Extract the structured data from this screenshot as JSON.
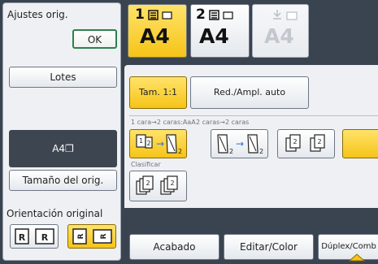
{
  "left": {
    "ajustes_label": "Ajustes orig.",
    "ok_label": "OK",
    "lotes_label": "Lotes",
    "paper_label": "A4❐",
    "tamano_label": "Tamaño del orig.",
    "orientacion_label": "Orientación original"
  },
  "trays": [
    {
      "number": "1",
      "size": "A4"
    },
    {
      "number": "2",
      "size": "A4"
    },
    {
      "number": "",
      "size": "A4"
    }
  ],
  "reduce": {
    "tam_label": "Tam. 1:1",
    "red_label": "Red./Ampl. auto"
  },
  "duplex": {
    "mode1": "1 cara→2 caras:AaA",
    "mode2": "2 caras→2 caras"
  },
  "sort": {
    "clasificar_label": "Clasificar"
  },
  "bottom": {
    "acabado": "Acabado",
    "editar": "Editar/Color",
    "duplex": "Dúplex/Comb"
  },
  "colors": {
    "accent": "#f6c418",
    "panel": "#eef0f3",
    "background": "#3a4350"
  }
}
